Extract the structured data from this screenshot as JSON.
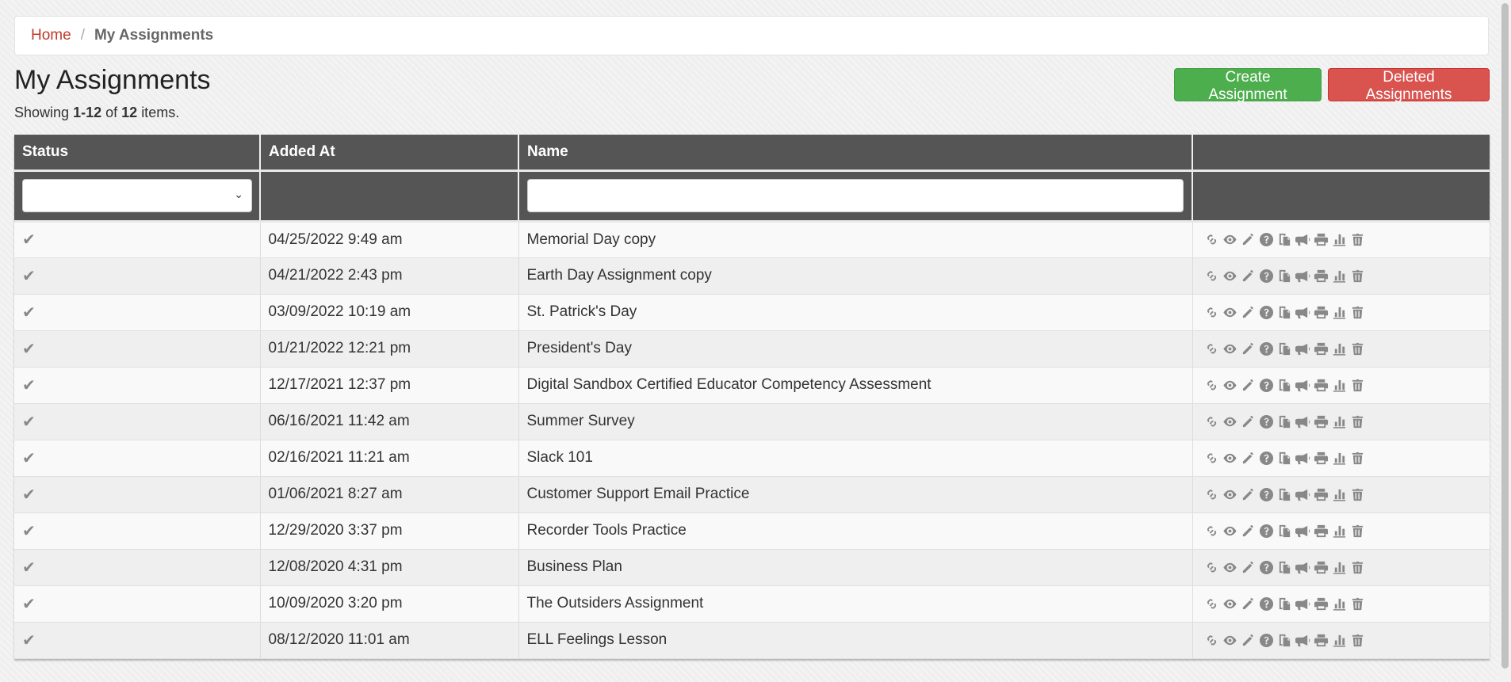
{
  "breadcrumb": {
    "home": "Home",
    "separator": "/",
    "current": "My Assignments"
  },
  "page": {
    "title": "My Assignments",
    "summary_prefix": "Showing",
    "summary_range": "1-12",
    "summary_of": "of",
    "summary_total": "12",
    "summary_suffix": "items."
  },
  "buttons": {
    "create": "Create Assignment",
    "deleted": "Deleted Assignments"
  },
  "colors": {
    "create": "#4cae4c",
    "deleted": "#d9534f",
    "header": "#555555",
    "link": "#c0392b"
  },
  "table": {
    "columns": [
      "Status",
      "Added At",
      "Name",
      ""
    ],
    "filters": {
      "status_value": "",
      "name_value": ""
    },
    "row_actions": [
      "link-icon",
      "eye-icon",
      "pencil-icon",
      "question-icon",
      "copy-icon",
      "megaphone-icon",
      "print-icon",
      "bar-chart-icon",
      "trash-icon"
    ],
    "rows": [
      {
        "status": "✔",
        "added_at": "04/25/2022 9:49 am",
        "name": "Memorial Day copy"
      },
      {
        "status": "✔",
        "added_at": "04/21/2022 2:43 pm",
        "name": "Earth Day Assignment copy"
      },
      {
        "status": "✔",
        "added_at": "03/09/2022 10:19 am",
        "name": "St. Patrick's Day"
      },
      {
        "status": "✔",
        "added_at": "01/21/2022 12:21 pm",
        "name": "President's Day"
      },
      {
        "status": "✔",
        "added_at": "12/17/2021 12:37 pm",
        "name": "Digital Sandbox Certified Educator Competency Assessment"
      },
      {
        "status": "✔",
        "added_at": "06/16/2021 11:42 am",
        "name": "Summer Survey"
      },
      {
        "status": "✔",
        "added_at": "02/16/2021 11:21 am",
        "name": "Slack 101"
      },
      {
        "status": "✔",
        "added_at": "01/06/2021 8:27 am",
        "name": "Customer Support Email Practice"
      },
      {
        "status": "✔",
        "added_at": "12/29/2020 3:37 pm",
        "name": "Recorder Tools Practice"
      },
      {
        "status": "✔",
        "added_at": "12/08/2020 4:31 pm",
        "name": "Business Plan"
      },
      {
        "status": "✔",
        "added_at": "10/09/2020 3:20 pm",
        "name": "The Outsiders Assignment"
      },
      {
        "status": "✔",
        "added_at": "08/12/2020 11:01 am",
        "name": "ELL Feelings Lesson"
      }
    ]
  }
}
